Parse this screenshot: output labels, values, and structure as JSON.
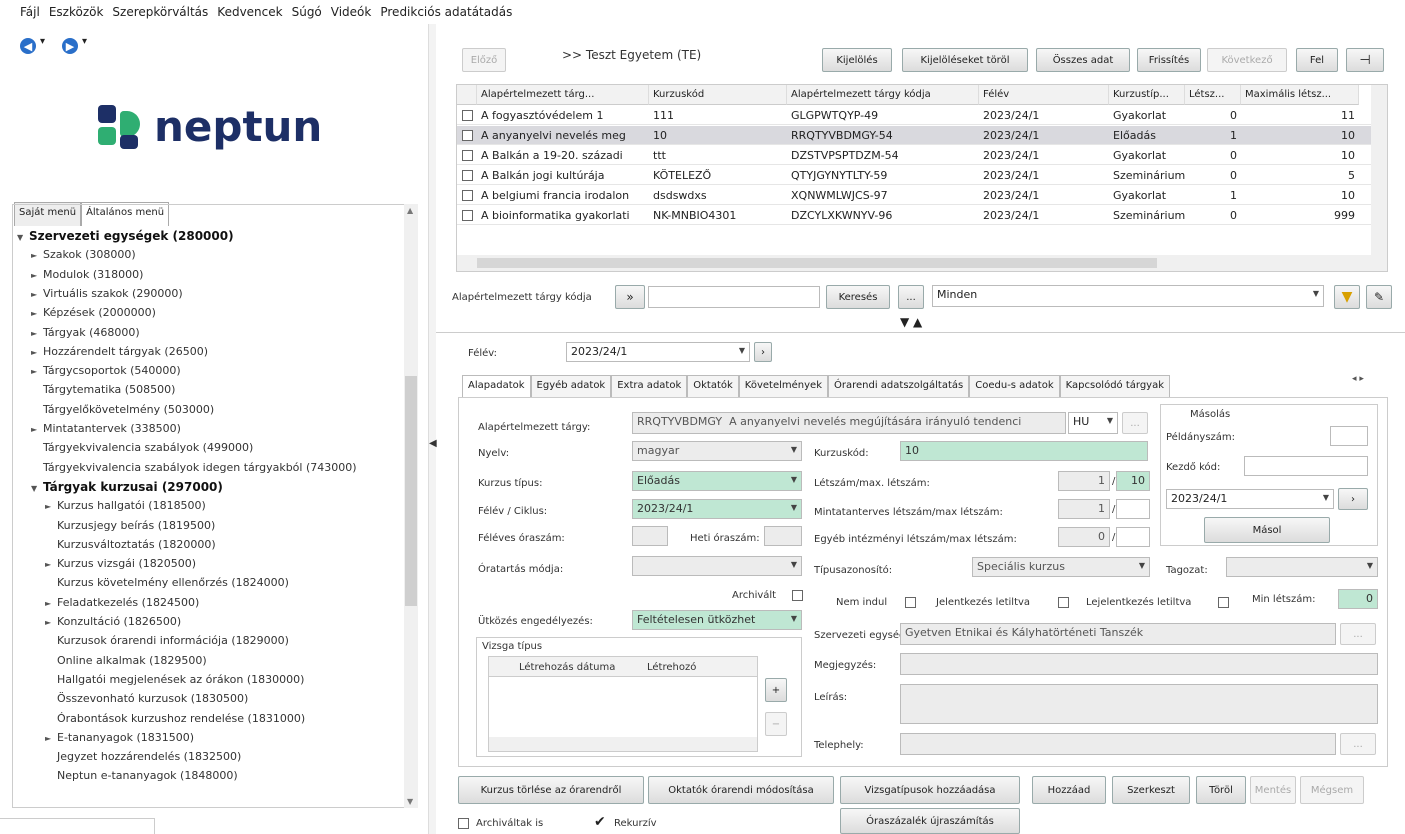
{
  "menu": [
    "Fájl",
    "Eszközök",
    "Szerepkörváltás",
    "Kedvencek",
    "Súgó",
    "Videók",
    "Predikciós adatátadás"
  ],
  "left": {
    "logo_text": "neptun",
    "tabs": [
      "Saját menü",
      "Általános menü"
    ],
    "tree": [
      {
        "label": "Szervezeti egységek (280000)",
        "level": 0,
        "bold": true,
        "arrow": "▼"
      },
      {
        "label": "Szakok (308000)",
        "level": 1,
        "arrow": "►"
      },
      {
        "label": "Modulok (318000)",
        "level": 1,
        "arrow": "►"
      },
      {
        "label": "Virtuális szakok (290000)",
        "level": 1,
        "arrow": "►"
      },
      {
        "label": "Képzések (2000000)",
        "level": 1,
        "arrow": "►"
      },
      {
        "label": "Tárgyak (468000)",
        "level": 1,
        "arrow": "►"
      },
      {
        "label": "Hozzárendelt tárgyak (26500)",
        "level": 1,
        "arrow": "►"
      },
      {
        "label": "Tárgycsoportok (540000)",
        "level": 1,
        "arrow": "►"
      },
      {
        "label": "Tárgytematika (508500)",
        "level": 1,
        "arrow": ""
      },
      {
        "label": "Tárgyelőkövetelmény (503000)",
        "level": 1,
        "arrow": ""
      },
      {
        "label": "Mintatantervek (338500)",
        "level": 1,
        "arrow": "►"
      },
      {
        "label": "Tárgyekvivalencia szabályok (499000)",
        "level": 1,
        "arrow": ""
      },
      {
        "label": "Tárgyekvivalencia szabályok idegen tárgyakból (743000)",
        "level": 1,
        "arrow": ""
      },
      {
        "label": "Tárgyak kurzusai (297000)",
        "level": 1,
        "bold": true,
        "arrow": "▼"
      },
      {
        "label": "Kurzus hallgatói (1818500)",
        "level": 2,
        "arrow": "►"
      },
      {
        "label": "Kurzusjegy beírás (1819500)",
        "level": 2,
        "arrow": ""
      },
      {
        "label": "Kurzusváltoztatás (1820000)",
        "level": 2,
        "arrow": ""
      },
      {
        "label": "Kurzus vizsgái (1820500)",
        "level": 2,
        "arrow": "►"
      },
      {
        "label": "Kurzus követelmény ellenőrzés (1824000)",
        "level": 2,
        "arrow": ""
      },
      {
        "label": "Feladatkezelés (1824500)",
        "level": 2,
        "arrow": "►"
      },
      {
        "label": "Konzultáció (1826500)",
        "level": 2,
        "arrow": "►"
      },
      {
        "label": "Kurzusok órarendi információja (1829000)",
        "level": 2,
        "arrow": ""
      },
      {
        "label": "Online alkalmak (1829500)",
        "level": 2,
        "arrow": ""
      },
      {
        "label": "Hallgatói megjelenések az órákon (1830000)",
        "level": 2,
        "arrow": ""
      },
      {
        "label": "Összevonható kurzusok (1830500)",
        "level": 2,
        "arrow": ""
      },
      {
        "label": "Órabontások kurzushoz rendelése (1831000)",
        "level": 2,
        "arrow": ""
      },
      {
        "label": "E-tananyagok (1831500)",
        "level": 2,
        "arrow": "►"
      },
      {
        "label": "Jegyzet hozzárendelés (1832500)",
        "level": 2,
        "arrow": ""
      },
      {
        "label": "Neptun e-tananyagok (1848000)",
        "level": 2,
        "arrow": ""
      }
    ]
  },
  "toolbar": {
    "back": "Előző",
    "breadcrumb": ">> Teszt Egyetem (TE)",
    "buttons": [
      "Kijelölés",
      "Kijelöléseket töröl",
      "Összes adat",
      "Frissítés",
      "Következő",
      "Fel"
    ]
  },
  "grid": {
    "columns": [
      "Alapértelmezett tárg...",
      "Kurzuskód",
      "Alapértelmezett tárgy kódja",
      "Félév",
      "Kurzustíp...",
      "Létsz...",
      "Maximális létsz..."
    ],
    "rows": [
      [
        "A fogyasztóvédelem 1",
        "111",
        "GLGPWTQYP-49",
        "2023/24/1",
        "Gyakorlat",
        "0",
        "11"
      ],
      [
        "A anyanyelvi nevelés meg",
        "10",
        "RRQTYVBDMGY-54",
        "2023/24/1",
        "Előadás",
        "1",
        "10"
      ],
      [
        "A Balkán a 19-20. századi",
        "ttt",
        "DZSTVPSPTDZM-54",
        "2023/24/1",
        "Gyakorlat",
        "0",
        "10"
      ],
      [
        "A Balkán jogi kultúrája",
        "KÖTELEZŐ",
        "QTYJGYNYTLTY-59",
        "2023/24/1",
        "Szeminárium",
        "0",
        "5"
      ],
      [
        "A belgiumi francia irodalon",
        "dsdswdxs",
        "XQNWMLWJCS-97",
        "2023/24/1",
        "Gyakorlat",
        "1",
        "10"
      ],
      [
        "A bioinformatika gyakorlati",
        "NK-MNBIO4301",
        "DZCYLXKWNYV-96",
        "2023/24/1",
        "Szeminárium",
        "0",
        "999"
      ]
    ]
  },
  "search": {
    "label": "Alapértelmezett tárgy kódja",
    "button": "Keresés",
    "filter": "Minden"
  },
  "semester": {
    "label": "Félév:",
    "value": "2023/24/1"
  },
  "tabs": [
    "Alapadatok",
    "Egyéb adatok",
    "Extra adatok",
    "Oktatók",
    "Követelmények",
    "Órarendi adatszolgáltatás",
    "Coedu-s adatok",
    "Kapcsolódó tárgyak"
  ],
  "form": {
    "subject_label": "Alapértelmezett tárgy:",
    "subject_code": "RRQTYVBDMGY",
    "subject_name": "A anyanyelvi nevelés megújítására irányuló tendenci",
    "lang_code": "HU",
    "lang_label": "Nyelv:",
    "lang_value": "magyar",
    "course_code_label": "Kurzuskód:",
    "course_code": "10",
    "type_label": "Kurzus típus:",
    "type_value": "Előadás",
    "headcount_label": "Létszám/max. létszám:",
    "headcount": "1",
    "headcount_max": "10",
    "semester_label": "Félév / Ciklus:",
    "semester_value": "2023/24/1",
    "curr_label": "Mintatanterves létszám/max létszám:",
    "curr_value": "1",
    "hours_label": "Féléves óraszám:",
    "weekly_label": "Heti óraszám:",
    "other_label": "Egyéb intézményi létszám/max létszám:",
    "other_value": "0",
    "mode_label": "Óratartás módja:",
    "typeid_label": "Típusazonosító:",
    "typeid_value": "Speciális kurzus",
    "section_label": "Tagozat:",
    "archived_label": "Archivált",
    "not_started_label": "Nem indul",
    "enroll_locked_label": "Jelentkezés letiltva",
    "unenroll_locked_label": "Lejelentkezés letiltva",
    "min_label": "Min létszám:",
    "min_value": "0",
    "collision_label": "Ütközés engedélyezés:",
    "collision_value": "Feltételesen ütközhet",
    "org_label": "Szervezeti egység:",
    "org_value": "Gyetven Etnikai és Kályhatörténeti Tanszék",
    "note_label": "Megjegyzés:",
    "desc_label": "Leírás:",
    "site_label": "Telephely:",
    "exam_title": "Vizsga típus",
    "exam_cols": [
      "Létrehozás dátuma",
      "Létrehozó"
    ]
  },
  "copy": {
    "title": "Másolás",
    "count_label": "Példányszám:",
    "start_label": "Kezdő kód:",
    "semester": "2023/24/1",
    "button": "Másol"
  },
  "bottom": {
    "buttons_left": [
      "Kurzus törlése az órarendről",
      "Oktatók órarendi módosítása",
      "Vizsgatípusok hozzáadása"
    ],
    "buttons_right": [
      "Hozzáad",
      "Szerkeszt",
      "Töröl",
      "Mentés",
      "Mégsem"
    ],
    "renumber": "Óraszázalék újraszámítás",
    "archived": "Archiváltak is",
    "recursive": "Rekurzív"
  },
  "colors": {
    "accent_green": "#bfe7d3",
    "selected_row": "#d9d9de",
    "logo_blue": "#1d2f66",
    "logo_green": "#2fae72"
  }
}
